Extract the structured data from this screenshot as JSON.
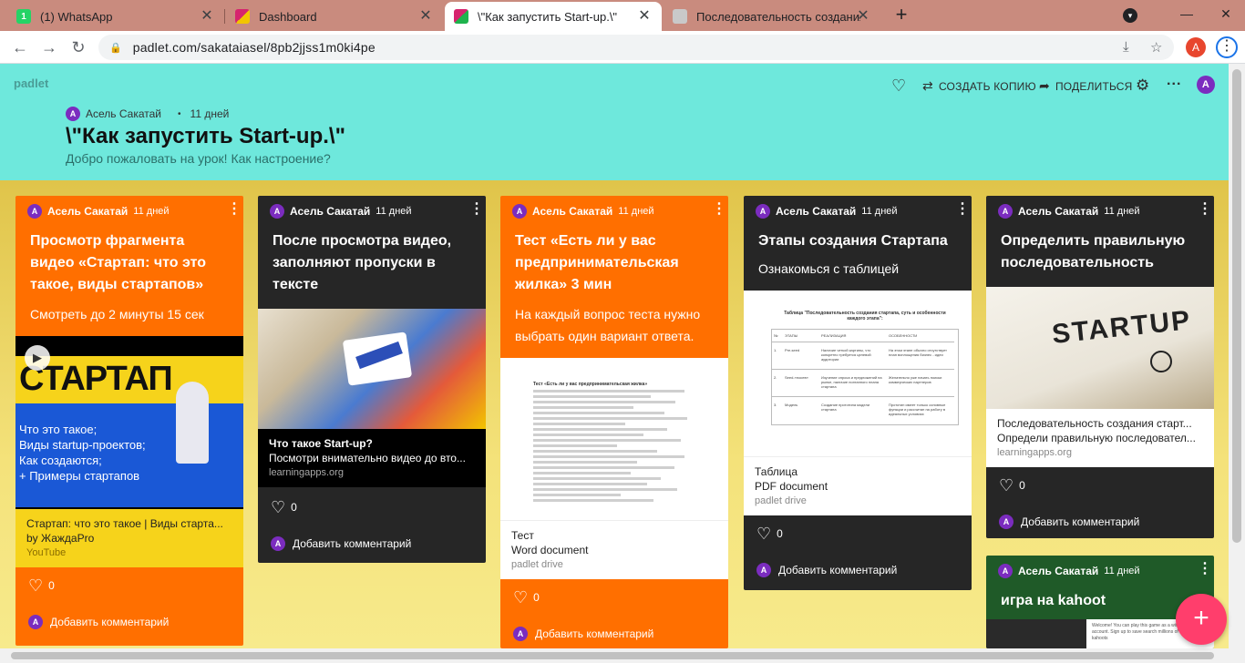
{
  "browser": {
    "tabs": [
      {
        "title": "(1) WhatsApp",
        "favicon": "whatsapp-icon",
        "color": "#25d366"
      },
      {
        "title": "Dashboard",
        "favicon": "padlet-icon",
        "color": "#d6246e"
      },
      {
        "title": "\\\"Как запустить Start-up.\\\"",
        "favicon": "padlet-icon",
        "color": "#d6246e"
      },
      {
        "title": "Последовательность создания с",
        "favicon": "learningapps-icon",
        "color": "#c9c9c9"
      }
    ],
    "url": "padlet.com/sakataiasel/8pb2jjss1m0ki4pe",
    "profile_initial": "A"
  },
  "header": {
    "brand": "padlet",
    "copy_label": "СОЗДАТЬ КОПИЮ",
    "share_label": "ПОДЕЛИТЬСЯ",
    "author": "Асель Сакатай",
    "age": "11 дней",
    "title": "\\\"Как запустить Start-up.\\\"",
    "subtitle": "Добро пожаловать на урок! Как настроение?",
    "avatar_initial": "A"
  },
  "cards": [
    {
      "author": "Асель Сакатай",
      "age": "11 дней",
      "title": "Просмотр фрагмента видео «Стартап: что это такое, виды стартапов»",
      "body": "Смотреть до 2 минуты 15 сек",
      "media_big": "СТАРТАП",
      "media_lines": [
        "Что это такое;",
        "Виды startup-проектов;",
        "Как создаются;",
        "+ Примеры стартапов"
      ],
      "link_title": "Стартап: что это такое | Виды старта...",
      "link_desc": "by ЖаждаPro",
      "link_source": "YouTube",
      "likes": "0",
      "comment": "Добавить комментарий"
    },
    {
      "author": "Асель Сакатай",
      "age": "11 дней",
      "title": "После просмотра видео, заполняют пропуски в тексте",
      "link_title": "Что такое Start-up?",
      "link_desc": "Посмотри внимательно видео до вто...",
      "link_source": "learningapps.org",
      "likes": "0",
      "comment": "Добавить комментарий"
    },
    {
      "author": "Асель Сакатай",
      "age": "11 дней",
      "title": "Тест «Есть ли у вас предпринимательская жилка» 3 мин",
      "body": "На каждый вопрос теста нужно выбрать один вариант ответа.",
      "doc_heading": "Тест «Есть ли у вас предпринимательская жилка»",
      "link_title": "Тест",
      "link_desc": "Word document",
      "link_source": "padlet drive",
      "likes": "0",
      "comment": "Добавить комментарий"
    },
    {
      "author": "Асель Сакатай",
      "age": "11 дней",
      "title": "Этапы создания Стартапа",
      "body": "Ознакомься с таблицей",
      "doc_heading": "Таблица \"Последовательность создания стартапа, суть и особенности каждого этапа\":",
      "doc_cols": [
        "№",
        "ЭТАПЫ",
        "РЕАЛИЗАЦИЯ",
        "ОСОБЕННОСТИ"
      ],
      "doc_rows": [
        [
          "1.",
          "Pre-seed",
          "Наличие четкой картины, что конкретно требуется целевой аудитории",
          "На этом этапе обычно отсутствует план воплощения бизнес - идеи"
        ],
        [
          "2.",
          "Seed-«посев»",
          "Изучение спроса и предложений на рынке, наличие поэтапного плана стартапа",
          "Желательно уже начать поиски коммерческих партнеров"
        ],
        [
          "3.",
          "Модель",
          "Создание прототипа модели стартапа",
          "Прототип имеет только основные функции и рассчитан на работу в идеальных условиях"
        ]
      ],
      "link_title": "Таблица",
      "link_desc": "PDF document",
      "link_source": "padlet drive",
      "likes": "0",
      "comment": "Добавить комментарий"
    },
    {
      "author": "Асель Сакатай",
      "age": "11 дней",
      "title": "Определить правильную последовательность",
      "media_big": "STARTUP",
      "link_title": "Последовательность создания старт...",
      "link_desc": "Определи правильную последовател...",
      "link_source": "learningapps.org",
      "likes": "0",
      "comment": "Добавить комментарий"
    },
    {
      "author": "Асель Сакатай",
      "age": "11 дней",
      "title": "игра на kahoot",
      "doc_text": "Welcome! You can play this game as a without an account. Sign up to save search millions of awesome kahoots"
    }
  ],
  "fab_label": "+",
  "colors": {
    "orange": "#ff6f00",
    "dark": "#262626",
    "green": "#1f5a28",
    "header": "#6ee8dc",
    "fab": "#ff3e6c"
  }
}
